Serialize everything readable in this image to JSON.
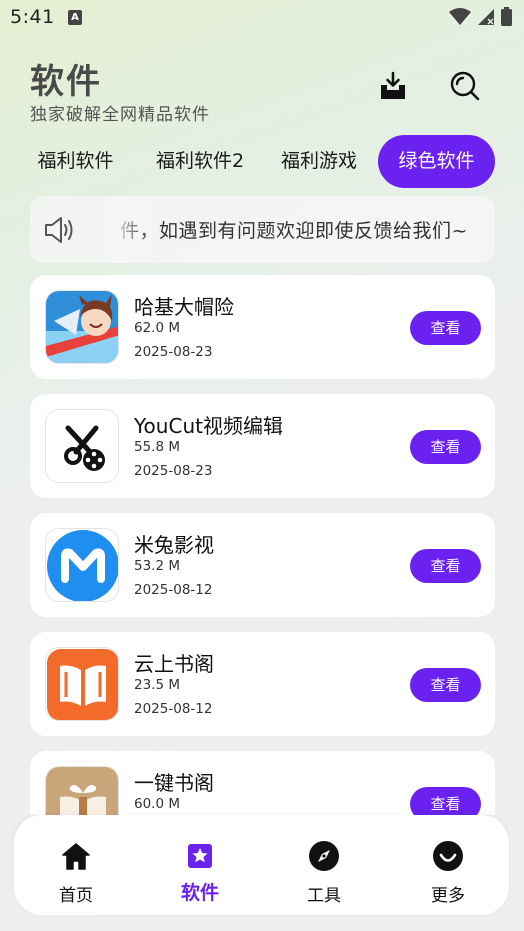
{
  "status_bar": {
    "time": "5:41",
    "badge": "A"
  },
  "header": {
    "title": "软件",
    "subtitle": "独家破解全网精品软件"
  },
  "tabs": [
    {
      "label": "福利软件"
    },
    {
      "label": "福利软件2"
    },
    {
      "label": "福利游戏"
    },
    {
      "label": "绿色软件"
    }
  ],
  "notice": {
    "text": "件，如遇到有问题欢迎即使反馈给我们~"
  },
  "apps": [
    {
      "name": "哈基大帽险",
      "size": "62.0 M",
      "date": "2025-08-23",
      "button": "查看",
      "icon": "game-icon"
    },
    {
      "name": "YouCut视频编辑",
      "size": "55.8 M",
      "date": "2025-08-23",
      "button": "查看",
      "icon": "scissors-icon"
    },
    {
      "name": "米兔影视",
      "size": "53.2 M",
      "date": "2025-08-12",
      "button": "查看",
      "icon": "m-logo-icon"
    },
    {
      "name": "云上书阁",
      "size": "23.5 M",
      "date": "2025-08-12",
      "button": "查看",
      "icon": "book-icon"
    },
    {
      "name": "一键书阁",
      "size": "60.0 M",
      "date": "",
      "button": "查看",
      "icon": "book-gift-icon"
    }
  ],
  "bottom_nav": [
    {
      "label": "首页",
      "icon": "home-icon"
    },
    {
      "label": "软件",
      "icon": "star-bookmark-icon"
    },
    {
      "label": "工具",
      "icon": "compass-icon"
    },
    {
      "label": "更多",
      "icon": "smile-icon"
    }
  ],
  "colors": {
    "accent": "#6b22f0"
  }
}
